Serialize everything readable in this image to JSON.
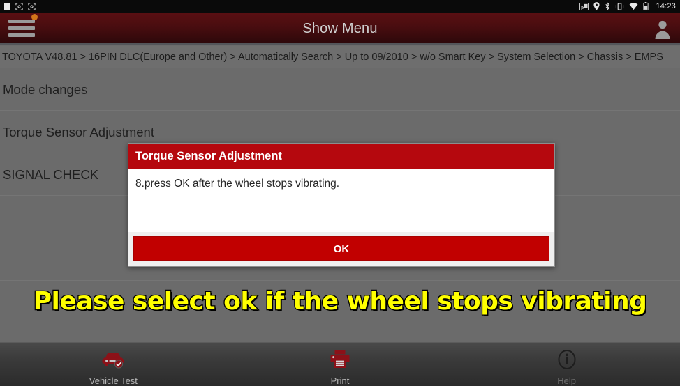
{
  "statusbar": {
    "time": "14:23",
    "left_icons": [
      "white-square-icon",
      "screenshot-capture-icon",
      "screenshot-capture-icon"
    ],
    "right_icons": [
      "screen-cast-icon",
      "location-pin-icon",
      "bluetooth-icon",
      "vibrate-icon",
      "wifi-icon",
      "battery-icon"
    ]
  },
  "titlebar": {
    "title": "Show Menu",
    "menu_icon": "hamburger-menu-icon",
    "badge": "notification-dot",
    "avatar_icon": "user-avatar-icon"
  },
  "breadcrumb": {
    "path": "TOYOTA V48.81 > 16PIN DLC(Europe and Other) > Automatically Search > Up to 09/2010 > w/o Smart Key > System Selection > Chassis > EMPS"
  },
  "menu": {
    "items": [
      {
        "label": "Mode changes"
      },
      {
        "label": "Torque Sensor Adjustment"
      },
      {
        "label": "SIGNAL CHECK"
      }
    ]
  },
  "dialog": {
    "title": "Torque Sensor Adjustment",
    "message": "8.press OK after the wheel stops vibrating.",
    "ok_label": "OK"
  },
  "caption": {
    "text": "Please select ok if the wheel stops vibrating"
  },
  "bottombar": {
    "items": [
      {
        "icon": "car-check-icon",
        "label": "Vehicle Test"
      },
      {
        "icon": "printer-icon",
        "label": "Print"
      },
      {
        "icon": "info-circle-icon",
        "label": "Help"
      }
    ]
  },
  "colors": {
    "brand_red": "#b5080e",
    "button_red": "#c10000",
    "titlebar_dark_red": "#4a0d10",
    "page_gray": "#6b6b6b",
    "caption_yellow": "#ffff00",
    "badge_orange": "#d2761a"
  }
}
